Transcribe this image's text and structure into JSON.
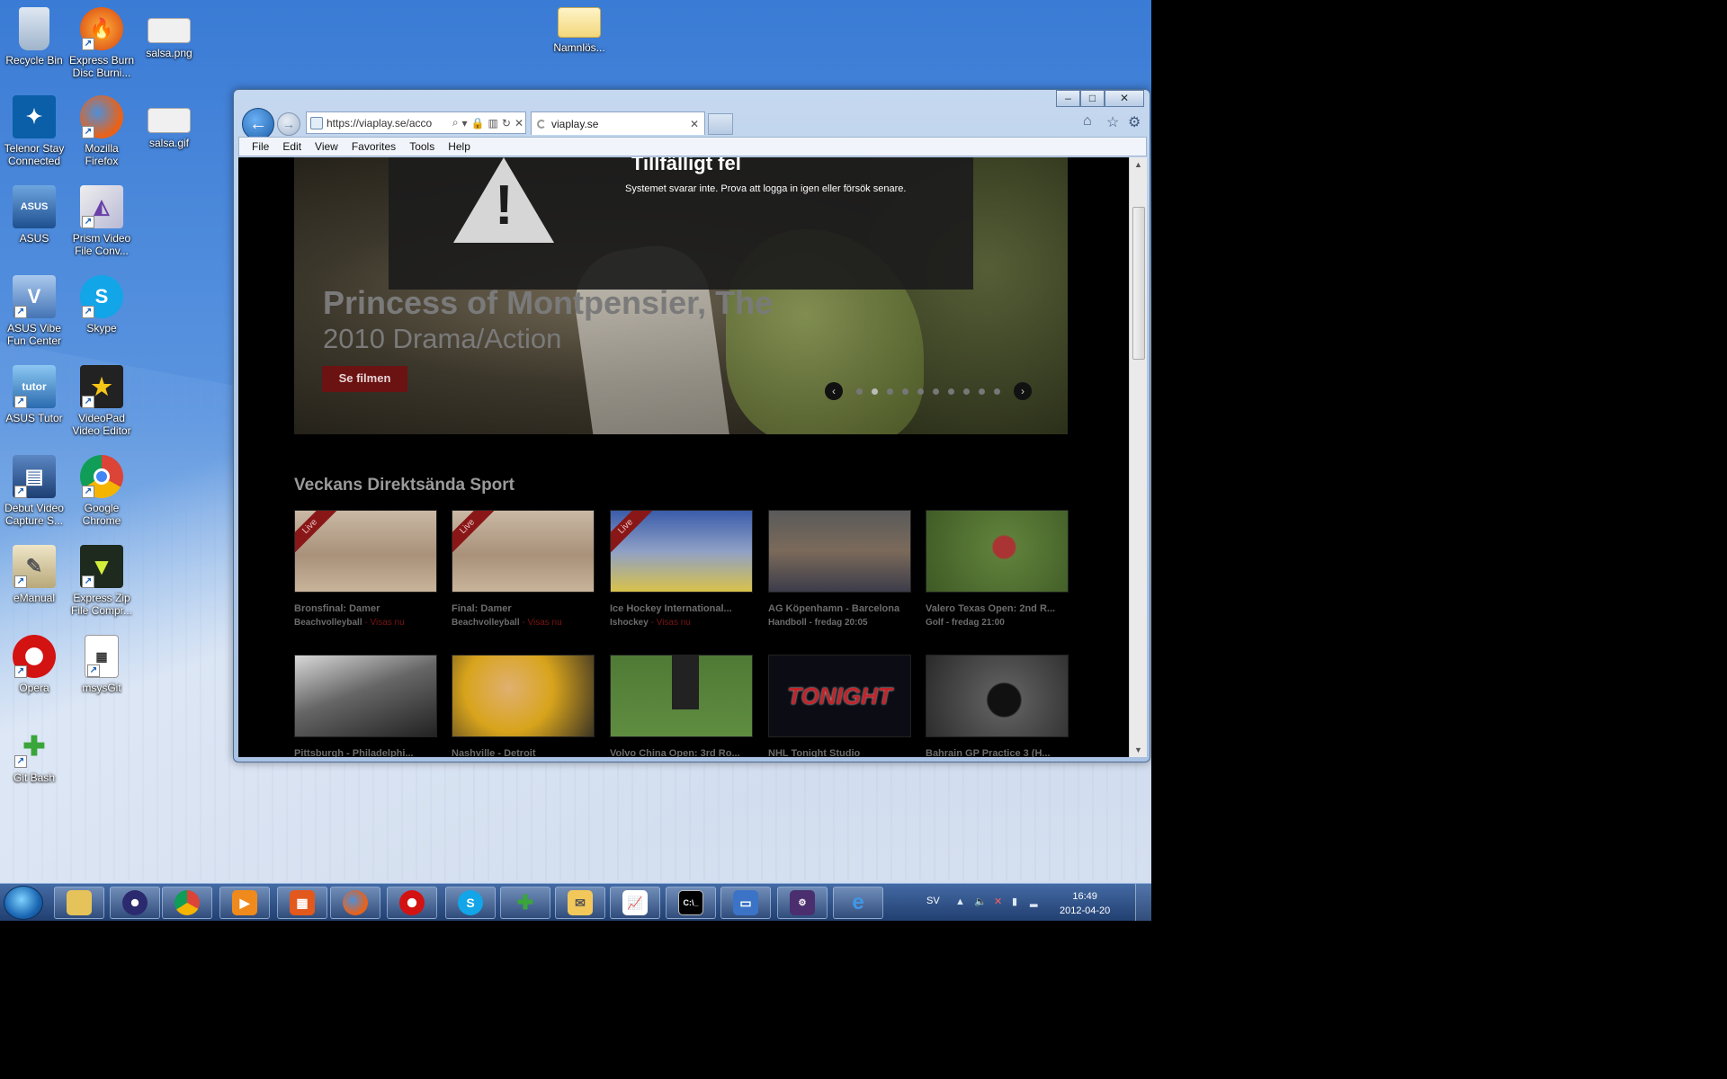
{
  "desktop": {
    "icons": [
      {
        "label": "Recycle Bin",
        "icon": "recycle-bin-icon"
      },
      {
        "label": "Express Burn Disc Burni...",
        "icon": "express-burn-icon"
      },
      {
        "label": "salsa.png",
        "icon": "image-file-icon"
      },
      {
        "label": "Namnlös...",
        "icon": "mail-envelope-icon"
      },
      {
        "label": "Telenor Stay Connected",
        "icon": "telenor-icon"
      },
      {
        "label": "Mozilla Firefox",
        "icon": "firefox-icon"
      },
      {
        "label": "salsa.gif",
        "icon": "image-file-icon"
      },
      {
        "label": "ASUS",
        "icon": "asus-icon"
      },
      {
        "label": "Prism Video File Conv...",
        "icon": "prism-icon"
      },
      {
        "label": "ASUS Vibe Fun Center",
        "icon": "asus-vibe-icon"
      },
      {
        "label": "Skype",
        "icon": "skype-icon"
      },
      {
        "label": "ASUS Tutor",
        "icon": "asus-tutor-icon"
      },
      {
        "label": "VideoPad Video Editor",
        "icon": "videopad-icon"
      },
      {
        "label": "Debut Video Capture S...",
        "icon": "debut-icon"
      },
      {
        "label": "Google Chrome",
        "icon": "chrome-icon"
      },
      {
        "label": "eManual",
        "icon": "emanual-icon"
      },
      {
        "label": "Express Zip File Compr...",
        "icon": "express-zip-icon"
      },
      {
        "label": "Opera",
        "icon": "opera-icon"
      },
      {
        "label": "msysGit",
        "icon": "msysgit-icon"
      },
      {
        "label": "Git Bash",
        "icon": "git-bash-icon"
      }
    ]
  },
  "browser": {
    "address": "https://viaplay.se/acco",
    "tab_title": "viaplay.se",
    "menu": [
      "File",
      "Edit",
      "View",
      "Favorites",
      "Tools",
      "Help"
    ],
    "window_buttons": {
      "minimize": "–",
      "maximize": "□",
      "close": "✕"
    }
  },
  "page": {
    "error": {
      "title": "Tillfälligt fel",
      "message": "Systemet svarar inte. Prova att logga in igen eller försök senare."
    },
    "hero": {
      "title": "Princess of Montpensier, The",
      "subtitle": "2010 Drama/Action",
      "cta": "Se filmen",
      "dots": 10,
      "active_dot": 1
    },
    "section_title": "Veckans Direktsända Sport",
    "row1": [
      {
        "title": "Bronsfinal: Damer",
        "sport": "Beachvolleyball",
        "live": " - Visas nu",
        "ribbon": "Live"
      },
      {
        "title": "Final: Damer",
        "sport": "Beachvolleyball",
        "live": " - Visas nu",
        "ribbon": "Live"
      },
      {
        "title": "Ice Hockey International...",
        "sport": "Ishockey",
        "live": " - Visas nu",
        "ribbon": "Live"
      },
      {
        "title": "AG Köpenhamn - Barcelona",
        "sport": "Handboll - fredag 20:05",
        "live": "",
        "ribbon": ""
      },
      {
        "title": "Valero Texas Open: 2nd R...",
        "sport": "Golf - fredag 21:00",
        "live": "",
        "ribbon": ""
      }
    ],
    "row2": [
      {
        "title": "Pittsburgh - Philadelphi..."
      },
      {
        "title": "Nashville - Detroit"
      },
      {
        "title": "Volvo China Open: 3rd Ro..."
      },
      {
        "title": "NHL Tonight Studio",
        "thumb_text": "TONIGHT"
      },
      {
        "title": "Bahrain GP Practice 3 (H..."
      }
    ]
  },
  "taskbar": {
    "apps": [
      "explorer",
      "eclipse",
      "chrome",
      "media-player",
      "ms-office",
      "firefox",
      "opera",
      "skype",
      "git",
      "outlook",
      "task-manager",
      "cmd",
      "remote-desktop",
      "java-ee-ide",
      "internet-explorer"
    ],
    "lang": "SV",
    "time": "16:49",
    "date": "2012-04-20"
  }
}
